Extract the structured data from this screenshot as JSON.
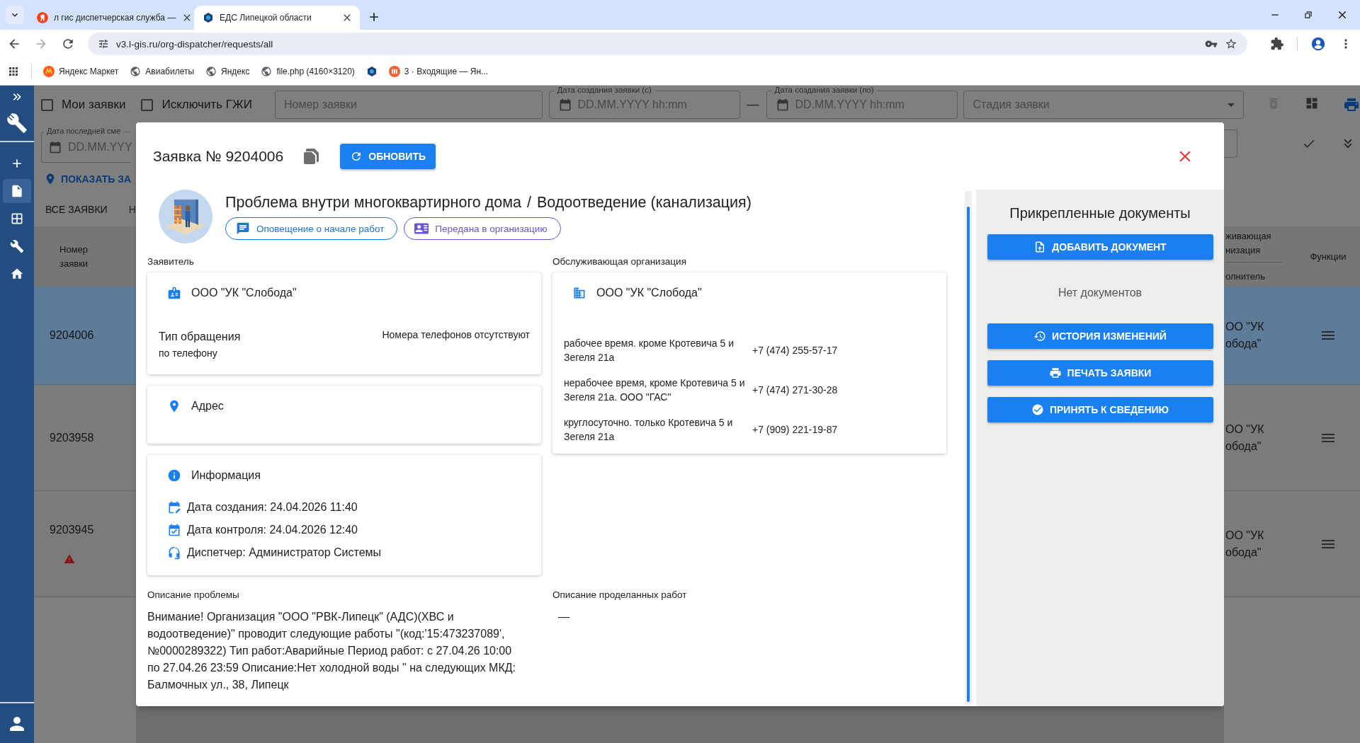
{
  "browser": {
    "tabs": [
      {
        "title": "л гис диспетчерская служба —",
        "kind": "search",
        "selected": false
      },
      {
        "title": "ЕДС Липецкой области",
        "kind": "site",
        "selected": true
      }
    ],
    "url": "v3.l-gis.ru/org-dispatcher/requests/all",
    "bookmarks": [
      {
        "kind": "market",
        "label": "Яндекс Маркет"
      },
      {
        "kind": "globe",
        "label": "Авиабилеты"
      },
      {
        "kind": "globe",
        "label": "Яндекс"
      },
      {
        "kind": "globe",
        "label": "file.php (4160×3120)"
      },
      {
        "kind": "site"
      },
      {
        "kind": "mail",
        "label": "3 · Входящие — Ян..."
      }
    ]
  },
  "sidebar": {
    "items": [
      {
        "kind": "add",
        "selected": false
      },
      {
        "kind": "document",
        "selected": true
      },
      {
        "kind": "table",
        "selected": false
      },
      {
        "kind": "wrench",
        "selected": false
      },
      {
        "kind": "home",
        "selected": false
      }
    ]
  },
  "filters": {
    "my_requests": {
      "label": "Мои заявки",
      "checked": false
    },
    "exclude_gji": {
      "label": "Исключить ГЖИ",
      "checked": false
    },
    "request_number": {
      "placeholder": "Номер заявки"
    },
    "created_from": {
      "label": "Дата создания заявки (с)",
      "placeholder": "DD.MM.YYYY hh:mm"
    },
    "range_separator": "—",
    "created_to": {
      "label": "Дата создания заявки (по)",
      "placeholder": "DD.MM.YYYY hh:mm"
    },
    "stage": {
      "placeholder": "Стадия заявки"
    },
    "last_change": {
      "label": "Дата последней сме",
      "placeholder": "DD.MM.YYY"
    }
  },
  "map_link": "ПОКАЗАТЬ ЗА",
  "list_tabs": [
    {
      "label": "ВСЕ ЗАЯВКИ",
      "selected": true
    },
    {
      "label": "Н",
      "selected": false
    }
  ],
  "table": {
    "number_header": "Номер заявки",
    "org_header": "живающая низация",
    "executor_header": "олнитель",
    "functions_header": "Функции",
    "rows": [
      {
        "number": "9204006",
        "org": "ОО \"УК обода\"",
        "selected": true,
        "warning": false
      },
      {
        "number": "9203958",
        "org": "ОО \"УК обода\"",
        "selected": false,
        "warning": false
      },
      {
        "number": "9203945",
        "org": "ОО \"УК обода\"",
        "selected": false,
        "warning": true
      }
    ]
  },
  "modal": {
    "title": "Заявка № 9204006",
    "refresh_button": "ОБНОВИТЬ",
    "category": "Проблема внутри многоквартирного дома",
    "separator": "/",
    "subcategory": "Водоотведение (канализация)",
    "chips": [
      {
        "kind": "notification",
        "label": "Оповещение о начале работ",
        "color": "#1a73e8"
      },
      {
        "kind": "transfer",
        "label": "Передана в организацию",
        "color": "#6b52d6"
      }
    ],
    "applicant": {
      "heading": "Заявитель",
      "name": "ООО \"УК \"Слобода\"",
      "type_label": "Тип обращения",
      "type_value": "по телефону",
      "phones": "Номера телефонов отсутствуют"
    },
    "address": {
      "heading": "Адрес"
    },
    "info": {
      "heading": "Информация",
      "rows": [
        {
          "kind": "created",
          "text": "Дата создания: 24.04.2026 11:40"
        },
        {
          "kind": "control",
          "text": "Дата контроля: 24.04.2026 12:40"
        },
        {
          "kind": "dispatcher",
          "text": "Диспетчер: Администратор Системы"
        }
      ]
    },
    "organization": {
      "heading": "Обслуживающая организация",
      "name": "ООО \"УК \"Слобода\"",
      "contacts": [
        {
          "note": "рабочее время. кроме Кротевича 5 и Зегеля 21а",
          "phone": "+7 (474) 255-57-17"
        },
        {
          "note": "нерабочее время, кроме Кротевича 5 и Зегеля 21а. ООО \"ГАС\"",
          "phone": "+7 (474) 271-30-28"
        },
        {
          "note": "круглосуточно. только Кротевича 5 и Зегеля 21а",
          "phone": "+7 (909) 221-19-87"
        }
      ]
    },
    "problem": {
      "heading": "Описание проблемы",
      "text": "Внимание! Организация \"ООО \"РВК-Липецк\" (АДС)(ХВС и водоотведение)\" проводит следующие работы \"(код:'15:473237089', №0000289322) Тип работ:Аварийные Период работ: с 27.04.26 10:00 по 27.04.26 23:59 Описание:Нет холодной воды \" на следующих МКД: Балмочных ул., 38, Липецк"
    },
    "work": {
      "heading": "Описание проделанных работ",
      "text": "—"
    },
    "documents": {
      "title": "Прикрепленные документы",
      "add_button": "ДОБАВИТЬ ДОКУМЕНТ",
      "empty": "Нет документов",
      "actions": [
        {
          "kind": "history",
          "label": "ИСТОРИЯ ИЗМЕНЕНИЙ"
        },
        {
          "kind": "print",
          "label": "ПЕЧАТЬ ЗАЯВКИ"
        },
        {
          "kind": "accept",
          "label": "ПРИНЯТЬ К СВЕДЕНИЮ"
        }
      ]
    }
  }
}
